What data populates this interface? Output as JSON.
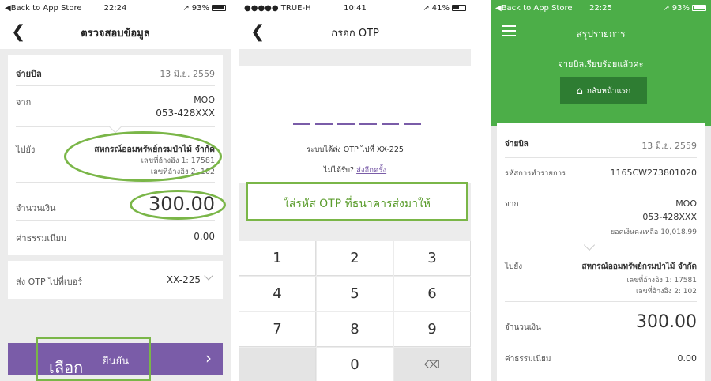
{
  "phone1": {
    "status": {
      "back_app": "◀Back to App Store",
      "time": "22:24",
      "battery": "93%",
      "signal": "↗"
    },
    "nav_title": "ตรวจสอบข้อมูล",
    "bill_label": "จ่ายบิล",
    "bill_date": "13 มิ.ย. 2559",
    "from_label": "จาก",
    "from_name": "MOO",
    "from_account": "053-428XXX",
    "to_label": "ไปยัง",
    "to_name": "สหกรณ์ออมทรัพย์กรมป่าไม้ จำกัด",
    "ref1": "เลขที่อ้างอิง 1: 17581",
    "ref2": "เลขที่อ้างอิง 2: 102",
    "amount_label": "จำนวนเงิน",
    "amount": "300.00",
    "fee_label": "ค่าธรรมเนียม",
    "fee": "0.00",
    "otp_label": "ส่ง OTP ไปที่เบอร์",
    "otp_number": "XX-225",
    "confirm_label": "ยืนยัน",
    "annotation_select": "เลือก",
    "chevron_right": "›"
  },
  "phone2": {
    "status": {
      "carrier": "●●●●● TRUE-H",
      "time": "10:41",
      "battery": "41%",
      "signal": "↗"
    },
    "nav_title": "กรอก OTP",
    "sent_text": "ระบบได้ส่ง OTP ไปที่ XX-225",
    "not_received": "ไม่ได้รับ?",
    "resend": "ส่งอีกครั้ง",
    "annotation_text": "ใส่รหัส OTP ที่ธนาคารส่งมาให้",
    "keys": [
      "1",
      "2",
      "3",
      "4",
      "5",
      "6",
      "7",
      "8",
      "9",
      "",
      "0",
      "⌫"
    ]
  },
  "phone3": {
    "status": {
      "back_app": "◀Back to App Store",
      "time": "22:25",
      "battery": "93%",
      "signal": "↗"
    },
    "nav_title": "สรุปรายการ",
    "success_msg": "จ่ายบิลเรียบร้อยแล้วค่ะ",
    "home_btn": "กลับหน้าแรก",
    "bill_label": "จ่ายบิล",
    "bill_date": "13 มิ.ย. 2559",
    "txn_label": "รหัสการทำรายการ",
    "txn_id": "1165CW273801020",
    "from_label": "จาก",
    "from_name": "MOO",
    "from_account": "053-428XXX",
    "balance": "ยอดเงินคงเหลือ 10,018.99",
    "to_label": "ไปยัง",
    "to_name": "สหกรณ์ออมทรัพย์กรมป่าไม้ จำกัด",
    "ref1": "เลขที่อ้างอิง 1: 17581",
    "ref2": "เลขที่อ้างอิง 2: 102",
    "amount_label": "จำนวนเงิน",
    "amount": "300.00",
    "fee_label": "ค่าธรรมเนียม",
    "fee": "0.00"
  },
  "colors": {
    "purple": "#7a5ca8",
    "green_header": "#4cae48",
    "annotation_green": "#7ab648"
  }
}
